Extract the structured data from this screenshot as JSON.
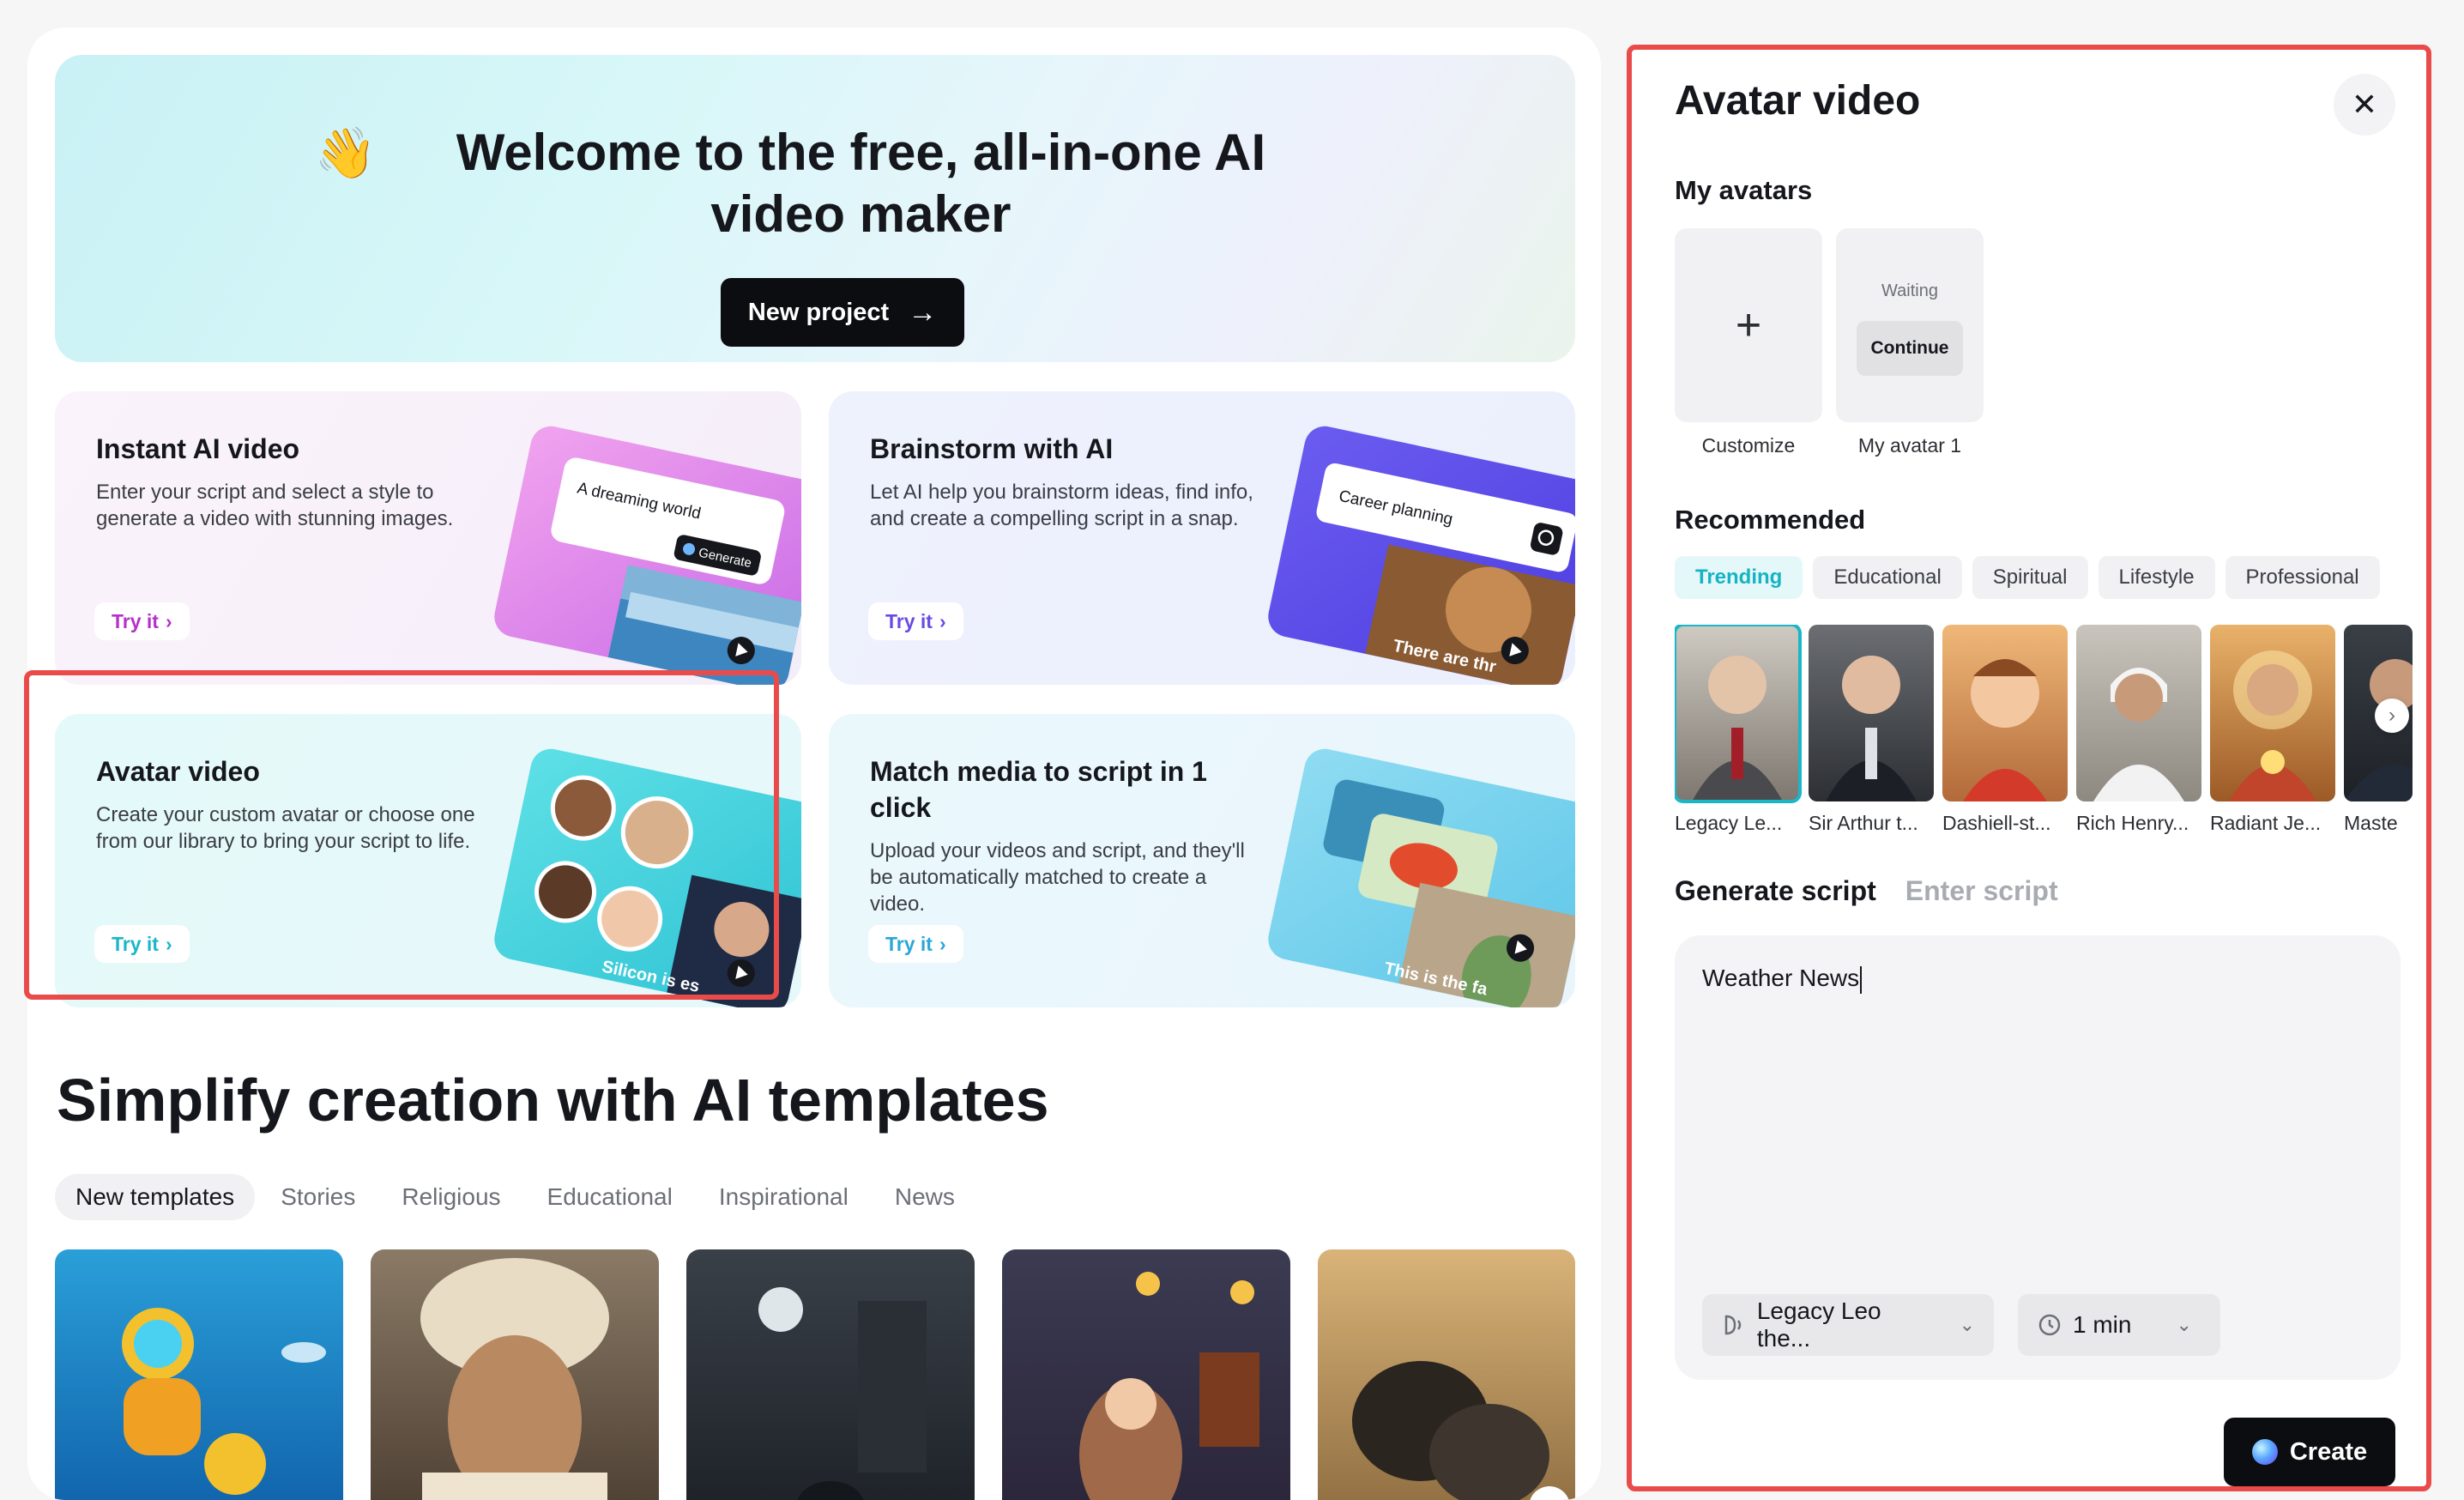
{
  "hero": {
    "wave_emoji": "👋",
    "title": "Welcome to the free, all-in-one AI video maker",
    "new_project_label": "New project"
  },
  "cards": [
    {
      "title": "Instant AI video",
      "desc": "Enter your script and select a style to generate a video with stunning images.",
      "cta": "Try it",
      "illus_text": "A dreaming world",
      "illus_button": "Generate"
    },
    {
      "title": "Brainstorm with AI",
      "desc": "Let AI help you brainstorm ideas, find info, and create a compelling script in a snap.",
      "cta": "Try it",
      "illus_text": "Career planning",
      "illus_caption": "There are thr"
    },
    {
      "title": "Avatar video",
      "desc": "Create your custom avatar or choose one from our library to bring your script to life.",
      "cta": "Try it",
      "illus_caption": "Silicon is es"
    },
    {
      "title": "Match media to script in 1 click",
      "desc": "Upload your videos and script, and they'll be automatically matched to create a video.",
      "cta": "Try it",
      "illus_caption": "This is the fa"
    }
  ],
  "templates": {
    "title": "Simplify creation with AI templates",
    "tabs": [
      "New templates",
      "Stories",
      "Religious",
      "Educational",
      "Inspirational",
      "News"
    ],
    "active_tab": "New templates"
  },
  "panel": {
    "title": "Avatar video",
    "my_avatars_heading": "My avatars",
    "customize_label": "Customize",
    "waiting_label": "Waiting",
    "continue_label": "Continue",
    "my_avatar_label": "My avatar 1",
    "recommended_heading": "Recommended",
    "chips": [
      "Trending",
      "Educational",
      "Spiritual",
      "Lifestyle",
      "Professional"
    ],
    "active_chip": "Trending",
    "avatars": [
      "Legacy Le...",
      "Sir Arthur t...",
      "Dashiell-st...",
      "Rich Henry...",
      "Radiant Je...",
      "Maste"
    ],
    "generate_tab": "Generate script",
    "enter_tab": "Enter script",
    "script_value": "Weather News",
    "voice_label": "Legacy Leo the...",
    "duration_label": "1 min",
    "create_label": "Create"
  },
  "colors": {
    "accent": "#1bb6c8",
    "highlight_outline": "#e94b4b",
    "button_dark": "#0c0d10"
  }
}
